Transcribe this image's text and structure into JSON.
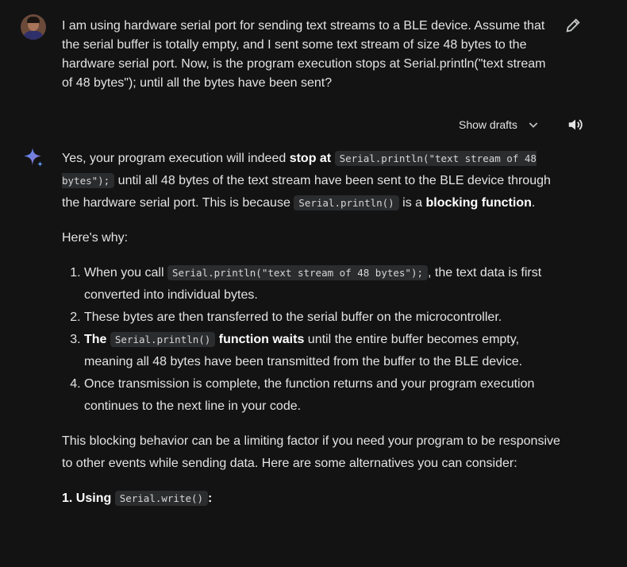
{
  "prompt": {
    "text": "I am using hardware serial port for sending text streams to a BLE device. Assume that the serial buffer is totally empty, and I sent some text stream of size 48 bytes to the hardware serial port. Now, is the program execution stops at Serial.println(\"text stream of 48 bytes\"); until all the bytes have been sent?"
  },
  "drafts": {
    "label": "Show drafts"
  },
  "answer": {
    "p1": {
      "a": "Yes, your program execution will indeed ",
      "b": "stop at",
      "c1": "Serial.println(\"text stream of 48 bytes\");",
      "d": " until all 48 bytes of the text stream have been sent to the BLE device through the hardware serial port. This is because ",
      "c2": "Serial.println()",
      "e": " is a ",
      "f": "blocking function",
      "g": "."
    },
    "p2": "Here's why:",
    "list": {
      "i1a": "When you call ",
      "i1c": "Serial.println(\"text stream of 48 bytes\");",
      "i1b": ", the text data is first converted into individual bytes.",
      "i2": "These bytes are then transferred to the serial buffer on the microcontroller.",
      "i3a": "The",
      "i3c": "Serial.println()",
      "i3b": "function waits",
      "i3d": " until the entire buffer becomes empty, meaning all 48 bytes have been transmitted from the buffer to the BLE device.",
      "i4": "Once transmission is complete, the function returns and your program execution continues to the next line in your code."
    },
    "p3": "This blocking behavior can be a limiting factor if you need your program to be responsive to other events while sending data. Here are some alternatives you can consider:",
    "h1": {
      "a": "1. Using ",
      "c": "Serial.write()",
      "b": ":"
    }
  }
}
